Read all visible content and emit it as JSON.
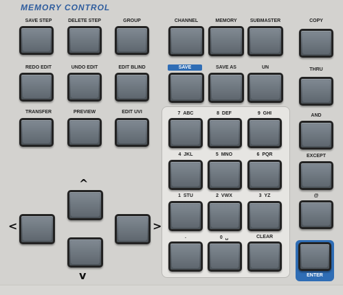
{
  "panel": {
    "title": "MEMORY CONTROL",
    "accent_color": "#2f6db5",
    "button_color": "#5d656d"
  },
  "labels": {
    "save_step": "SAVE STEP",
    "delete_step": "DELETE STEP",
    "group": "GROUP",
    "channel": "CHANNEL",
    "memory": "MEMORY",
    "submaster": "SUBMASTER",
    "copy": "COPY",
    "redo_edit": "REDO EDIT",
    "undo_edit": "UNDO EDIT",
    "edit_blind": "EDIT BLIND",
    "save": "SAVE",
    "save_as": "SAVE AS",
    "un": "UN",
    "thru": "THRU",
    "transfer": "TRANSFER",
    "preview": "PREVIEW",
    "edit_uvi": "EDIT UVI",
    "and": "AND",
    "except": "EXCEPT",
    "at": "@",
    "enter": "ENTER"
  },
  "keypad": [
    {
      "key": "7",
      "letters": "ABC"
    },
    {
      "key": "8",
      "letters": "DEF"
    },
    {
      "key": "9",
      "letters": "GHI"
    },
    {
      "key": "4",
      "letters": "JKL"
    },
    {
      "key": "5",
      "letters": "MNO"
    },
    {
      "key": "6",
      "letters": "PQR"
    },
    {
      "key": "1",
      "letters": "STU"
    },
    {
      "key": "2",
      "letters": "VWX"
    },
    {
      "key": "3",
      "letters": "YZ"
    },
    {
      "key": ".",
      "letters": ""
    },
    {
      "key": "0",
      "letters": "␣"
    },
    {
      "key": "CLEAR",
      "letters": ""
    }
  ],
  "arrows": {
    "up": "^",
    "down": "v",
    "left": "<",
    "right": ">"
  }
}
